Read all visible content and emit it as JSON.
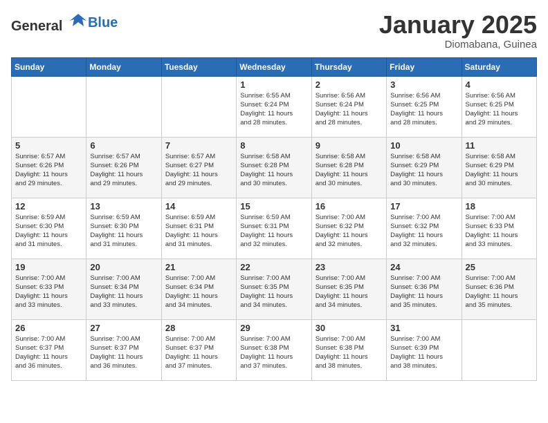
{
  "header": {
    "logo_general": "General",
    "logo_blue": "Blue",
    "month_title": "January 2025",
    "location": "Diomabana, Guinea"
  },
  "days_of_week": [
    "Sunday",
    "Monday",
    "Tuesday",
    "Wednesday",
    "Thursday",
    "Friday",
    "Saturday"
  ],
  "weeks": [
    [
      {
        "day": "",
        "info": ""
      },
      {
        "day": "",
        "info": ""
      },
      {
        "day": "",
        "info": ""
      },
      {
        "day": "1",
        "info": "Sunrise: 6:55 AM\nSunset: 6:24 PM\nDaylight: 11 hours\nand 28 minutes."
      },
      {
        "day": "2",
        "info": "Sunrise: 6:56 AM\nSunset: 6:24 PM\nDaylight: 11 hours\nand 28 minutes."
      },
      {
        "day": "3",
        "info": "Sunrise: 6:56 AM\nSunset: 6:25 PM\nDaylight: 11 hours\nand 28 minutes."
      },
      {
        "day": "4",
        "info": "Sunrise: 6:56 AM\nSunset: 6:25 PM\nDaylight: 11 hours\nand 29 minutes."
      }
    ],
    [
      {
        "day": "5",
        "info": "Sunrise: 6:57 AM\nSunset: 6:26 PM\nDaylight: 11 hours\nand 29 minutes."
      },
      {
        "day": "6",
        "info": "Sunrise: 6:57 AM\nSunset: 6:26 PM\nDaylight: 11 hours\nand 29 minutes."
      },
      {
        "day": "7",
        "info": "Sunrise: 6:57 AM\nSunset: 6:27 PM\nDaylight: 11 hours\nand 29 minutes."
      },
      {
        "day": "8",
        "info": "Sunrise: 6:58 AM\nSunset: 6:28 PM\nDaylight: 11 hours\nand 30 minutes."
      },
      {
        "day": "9",
        "info": "Sunrise: 6:58 AM\nSunset: 6:28 PM\nDaylight: 11 hours\nand 30 minutes."
      },
      {
        "day": "10",
        "info": "Sunrise: 6:58 AM\nSunset: 6:29 PM\nDaylight: 11 hours\nand 30 minutes."
      },
      {
        "day": "11",
        "info": "Sunrise: 6:58 AM\nSunset: 6:29 PM\nDaylight: 11 hours\nand 30 minutes."
      }
    ],
    [
      {
        "day": "12",
        "info": "Sunrise: 6:59 AM\nSunset: 6:30 PM\nDaylight: 11 hours\nand 31 minutes."
      },
      {
        "day": "13",
        "info": "Sunrise: 6:59 AM\nSunset: 6:30 PM\nDaylight: 11 hours\nand 31 minutes."
      },
      {
        "day": "14",
        "info": "Sunrise: 6:59 AM\nSunset: 6:31 PM\nDaylight: 11 hours\nand 31 minutes."
      },
      {
        "day": "15",
        "info": "Sunrise: 6:59 AM\nSunset: 6:31 PM\nDaylight: 11 hours\nand 32 minutes."
      },
      {
        "day": "16",
        "info": "Sunrise: 7:00 AM\nSunset: 6:32 PM\nDaylight: 11 hours\nand 32 minutes."
      },
      {
        "day": "17",
        "info": "Sunrise: 7:00 AM\nSunset: 6:32 PM\nDaylight: 11 hours\nand 32 minutes."
      },
      {
        "day": "18",
        "info": "Sunrise: 7:00 AM\nSunset: 6:33 PM\nDaylight: 11 hours\nand 33 minutes."
      }
    ],
    [
      {
        "day": "19",
        "info": "Sunrise: 7:00 AM\nSunset: 6:33 PM\nDaylight: 11 hours\nand 33 minutes."
      },
      {
        "day": "20",
        "info": "Sunrise: 7:00 AM\nSunset: 6:34 PM\nDaylight: 11 hours\nand 33 minutes."
      },
      {
        "day": "21",
        "info": "Sunrise: 7:00 AM\nSunset: 6:34 PM\nDaylight: 11 hours\nand 34 minutes."
      },
      {
        "day": "22",
        "info": "Sunrise: 7:00 AM\nSunset: 6:35 PM\nDaylight: 11 hours\nand 34 minutes."
      },
      {
        "day": "23",
        "info": "Sunrise: 7:00 AM\nSunset: 6:35 PM\nDaylight: 11 hours\nand 34 minutes."
      },
      {
        "day": "24",
        "info": "Sunrise: 7:00 AM\nSunset: 6:36 PM\nDaylight: 11 hours\nand 35 minutes."
      },
      {
        "day": "25",
        "info": "Sunrise: 7:00 AM\nSunset: 6:36 PM\nDaylight: 11 hours\nand 35 minutes."
      }
    ],
    [
      {
        "day": "26",
        "info": "Sunrise: 7:00 AM\nSunset: 6:37 PM\nDaylight: 11 hours\nand 36 minutes."
      },
      {
        "day": "27",
        "info": "Sunrise: 7:00 AM\nSunset: 6:37 PM\nDaylight: 11 hours\nand 36 minutes."
      },
      {
        "day": "28",
        "info": "Sunrise: 7:00 AM\nSunset: 6:37 PM\nDaylight: 11 hours\nand 37 minutes."
      },
      {
        "day": "29",
        "info": "Sunrise: 7:00 AM\nSunset: 6:38 PM\nDaylight: 11 hours\nand 37 minutes."
      },
      {
        "day": "30",
        "info": "Sunrise: 7:00 AM\nSunset: 6:38 PM\nDaylight: 11 hours\nand 38 minutes."
      },
      {
        "day": "31",
        "info": "Sunrise: 7:00 AM\nSunset: 6:39 PM\nDaylight: 11 hours\nand 38 minutes."
      },
      {
        "day": "",
        "info": ""
      }
    ]
  ]
}
